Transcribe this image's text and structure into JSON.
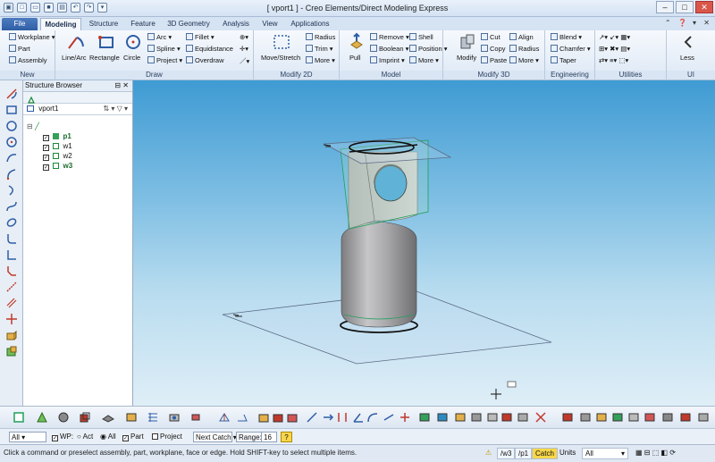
{
  "window": {
    "title": "[ vport1 ] - Creo Elements/Direct Modeling Express"
  },
  "tabs": [
    {
      "label": "File"
    },
    {
      "label": "Modeling"
    },
    {
      "label": "Structure"
    },
    {
      "label": "Feature"
    },
    {
      "label": "3D Geometry"
    },
    {
      "label": "Analysis"
    },
    {
      "label": "View"
    },
    {
      "label": "Applications"
    }
  ],
  "ribbon": {
    "new": {
      "label": "New",
      "items": [
        "Workplane",
        "Part",
        "Assembly"
      ]
    },
    "draw": {
      "label": "Draw",
      "buttons": [
        "Line/Arc",
        "Rectangle",
        "Circle"
      ],
      "items": [
        "Arc",
        "Spline",
        "Project",
        "Fillet",
        "Equidistance",
        "Overdraw"
      ]
    },
    "modify2d": {
      "label": "Modify 2D",
      "button": "Move/Stretch",
      "items": [
        "Radius",
        "Trim",
        "More"
      ]
    },
    "model": {
      "label": "Model",
      "button": "Pull",
      "items": [
        "Remove",
        "Boolean",
        "Imprint",
        "Shell",
        "Position",
        "More"
      ]
    },
    "modify3d": {
      "label": "Modify 3D",
      "button": "Modify",
      "items": [
        "Cut",
        "Copy",
        "Paste",
        "Align",
        "Radius",
        "More"
      ]
    },
    "engineering": {
      "label": "Engineering",
      "items": [
        "Blend",
        "Chamfer",
        "Taper"
      ]
    },
    "utilities": {
      "label": "Utilities"
    },
    "ui": {
      "label": "UI",
      "button": "Less"
    }
  },
  "browser": {
    "title": "Structure Browser",
    "viewport": "vport1",
    "items": [
      {
        "name": "p1",
        "color": "#1a8a3a"
      },
      {
        "name": "w1",
        "color": "#1a8a3a"
      },
      {
        "name": "w2",
        "color": "#1a8a3a"
      },
      {
        "name": "w3",
        "color": "#1a8a3a"
      }
    ]
  },
  "filter": {
    "scope": "All",
    "wp": "WP:",
    "act": "Act",
    "all": "All",
    "part": "Part",
    "project": "Project",
    "catch": "Next Catch",
    "range_label": "Range:",
    "range_value": "16"
  },
  "status": {
    "message": "Click a command or preselect assembly, part, workplane, face or edge. Hold SHIFT-key to select multiple items.",
    "workplane": "/w3",
    "part": "/p1",
    "catch": "Catch",
    "units": "Units",
    "units_value": "All"
  },
  "colors": {
    "accent": "#2e5ea5",
    "edge_green": "#1fa05a",
    "part_gray": "#9a9a9a"
  },
  "icons": {
    "help": "help-icon",
    "close": "close-icon"
  }
}
